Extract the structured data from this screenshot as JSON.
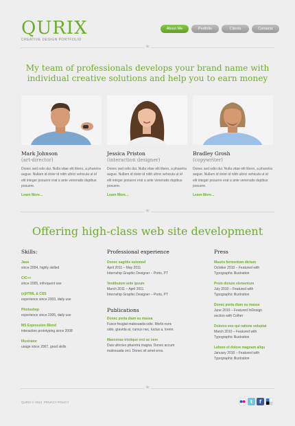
{
  "logo": {
    "name": "QURIX",
    "tagline": "CREATIVE DESIGN PORTFOLIO"
  },
  "nav": [
    {
      "label": "About Me",
      "active": true
    },
    {
      "label": "Portfolio",
      "active": false
    },
    {
      "label": "Clients",
      "active": false
    },
    {
      "label": "Contacts",
      "active": false
    }
  ],
  "headline1": "My team of professionals develops your brand name with individual creative solutions and help you to earn money",
  "team": [
    {
      "name": "Mark Johnson",
      "role": "(art-director)",
      "bio": "Donec sed odio dui. Nulla vitae elit libero, a pharetra augue. Nullam id dolor id nibh ultrici vehicula ut id elit integer posuere erat a ante venenatis dapibus posuere.",
      "link": "Learn More..."
    },
    {
      "name": "Jessica Priston",
      "role": "(interaction designer)",
      "bio": "Donec sed odio dui. Nulla vitae elit libero, a pharetra augue. Nullam id dolor id nibh ultrici vehicula ut id elit integer posuere erat a ante venenatis dapibus posuere.",
      "link": "Learn More..."
    },
    {
      "name": "Bradley Grosh",
      "role": "(copywriter)",
      "bio": "Donec sed odio dui. Nulla vitae elit libero, a pharetra augue. Nullam id dolor id nibh ultrici vehicula ut id elit integer posuere erat a ante venenatis dapibus posuere.",
      "link": "Learn More..."
    }
  ],
  "headline2": "Offering high-class web site development",
  "skills": {
    "title": "Skills:",
    "items": [
      {
        "title": "Java",
        "line": "since 2004, highly skilled"
      },
      {
        "title": "C/C++",
        "line": "since 2005, infrequent use"
      },
      {
        "title": "(x)HTML & CSS",
        "line": "experience since 2003, daily use"
      },
      {
        "title": "Photoshop",
        "line": "experience since 2005, daily use"
      },
      {
        "title": "MS Expression Blend",
        "line": "interaction prototyping since 2008"
      },
      {
        "title": "Illustrator",
        "line": "usage since 2007, good skills"
      }
    ]
  },
  "experience": {
    "title": "Professional experience",
    "items": [
      {
        "title": "Donec sagittis euismod",
        "lines": [
          "April 2011 – May 2011",
          "Internship Graphic Designer – Porto, PT"
        ]
      },
      {
        "title": "Vestibulum ante ipsum",
        "lines": [
          "March 2011 – April 2011",
          "Internship Graphic Designer – Porto, PT"
        ]
      }
    ]
  },
  "publications": {
    "title": "Publications",
    "items": [
      {
        "title": "Donec porta diam eu massa",
        "lines": [
          "Fusce feugiat malesuada odio. Morbi nunc",
          "odio, gravida at, cursus nec, luctus a, lorem."
        ]
      },
      {
        "title": "Maecenas tristique orci ac sem",
        "lines": [
          "Duis ultricies pharetra magna. Donec accum",
          "malesuada orci. Donec sit amet eros."
        ]
      }
    ]
  },
  "press": {
    "title": "Press",
    "items": [
      {
        "title": "Mauris fermentum dictum",
        "lines": [
          "October 2010 – Featured with",
          "Typographic Illustration"
        ]
      },
      {
        "title": "Proin dictum elementum",
        "lines": [
          "July 2010 – Featured with",
          "Typographic Illustration"
        ]
      },
      {
        "title": "Donec porta diam eu massa",
        "lines": [
          "June 2010 – Featured InDesign",
          "section with Colher"
        ]
      },
      {
        "title": "Dolores eos qui ratione voluptat",
        "lines": [
          "March 2010 – Featured with",
          "Typographic Illustration"
        ]
      },
      {
        "title": "Labore et dolore magnam aliqu",
        "lines": [
          "January 2010 – Featured with",
          "Typographic Illustration"
        ]
      }
    ]
  },
  "footer": {
    "copyright": "QURIX © 2012. PRIVACY POLICY"
  },
  "social_icons": [
    "flickr-icon",
    "twitter-icon",
    "facebook-icon",
    "delicious-icon"
  ],
  "colors": {
    "accent": "#6cae2a",
    "background": "#eeeeee"
  }
}
